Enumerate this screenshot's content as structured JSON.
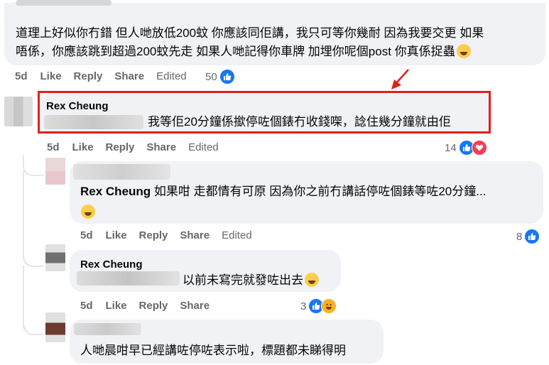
{
  "comment1": {
    "line1": "道理上好似你冇錯 但人哋放低200蚊 你應該同佢講，我只可等你幾耐 因為我要交更 如果",
    "line2": "唔係，你應該跳到超過200蚊先走 如果人哋記得你車牌 加埋你呢個post 你真係捉蟲",
    "actions": {
      "time": "5d",
      "like": "Like",
      "reply": "Reply",
      "share": "Share",
      "edited": "Edited"
    },
    "reaction_count": "50"
  },
  "comment2": {
    "author": "Rex Cheung",
    "text": "我等佢20分鐘係撳停咗個錶冇收錢㗎，諗住幾分鐘就由佢",
    "actions": {
      "time": "5d",
      "like": "Like",
      "reply": "Reply",
      "share": "Share",
      "edited": "Edited"
    },
    "reaction_count": "14"
  },
  "reply1": {
    "mention": "Rex Cheung",
    "text": " 如果咁 走都情有可原 因為你之前冇講話停咗個錶等咗20分鐘...",
    "actions": {
      "time": "5d",
      "like": "Like",
      "reply": "Reply",
      "share": "Share",
      "edited": "Edited"
    },
    "reaction_count": "8"
  },
  "reply2": {
    "mention": "Rex Cheung",
    "text": "以前未寫完就發咗出去",
    "actions": {
      "time": "5d",
      "like": "Like",
      "reply": "Reply",
      "share": "Share"
    },
    "reaction_count": "3"
  },
  "reply3": {
    "text": "人哋晨咁早已經講咗停咗表示啦，標題都未睇得明"
  },
  "colors": {
    "highlight_border": "#e0201b",
    "arrow": "#e0201b",
    "like_blue": "#1877f2",
    "bubble": "#f0f2f5"
  }
}
